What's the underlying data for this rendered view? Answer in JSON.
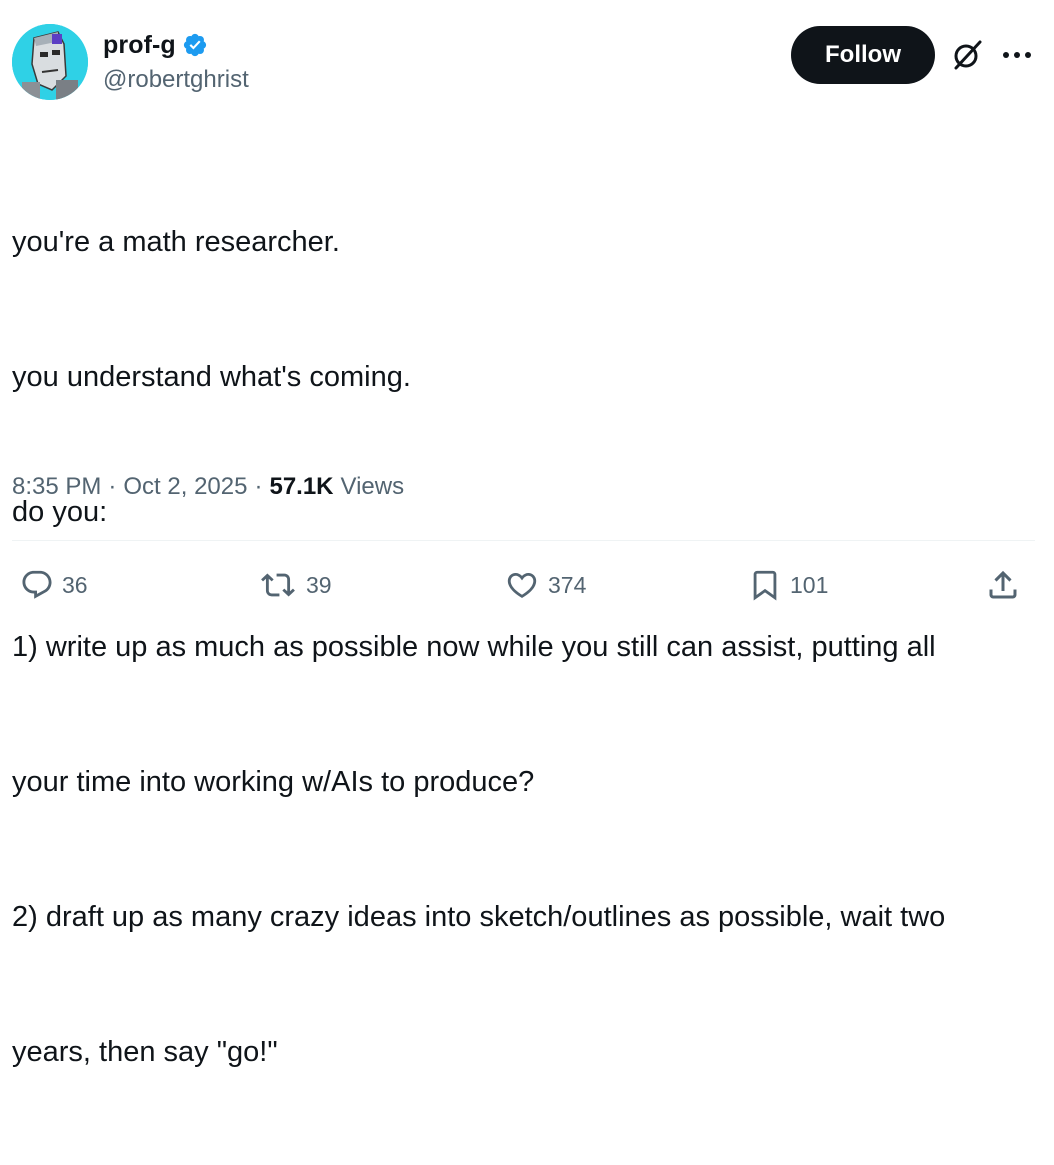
{
  "author": {
    "display_name": "prof-g",
    "handle": "@robertghrist",
    "verified": true,
    "verified_color": "#1d9bf0",
    "avatar_bg": "#2fd1e6"
  },
  "header": {
    "follow_label": "Follow",
    "grok_icon": "grok-icon",
    "more_icon": "more-icon"
  },
  "tweet": {
    "lines": [
      "you're a math researcher.",
      "you understand what's coming.",
      "do you:",
      "1) write up as much as possible now while you still can assist, putting all",
      "your time into working w/AIs to produce?",
      "2) draft up as many crazy ideas into sketch/outlines as possible, wait two",
      "years, then say \"go!\""
    ]
  },
  "meta": {
    "time": "8:35 PM",
    "separator": "·",
    "date": "Oct 2, 2025",
    "views_count": "57.1K",
    "views_label": "Views"
  },
  "actions": {
    "reply_count": "36",
    "retweet_count": "39",
    "like_count": "374",
    "bookmark_count": "101"
  },
  "colors": {
    "text_primary": "#0f1419",
    "text_secondary": "#536471",
    "follow_bg": "#0f1419",
    "divider": "#eff3f4"
  }
}
